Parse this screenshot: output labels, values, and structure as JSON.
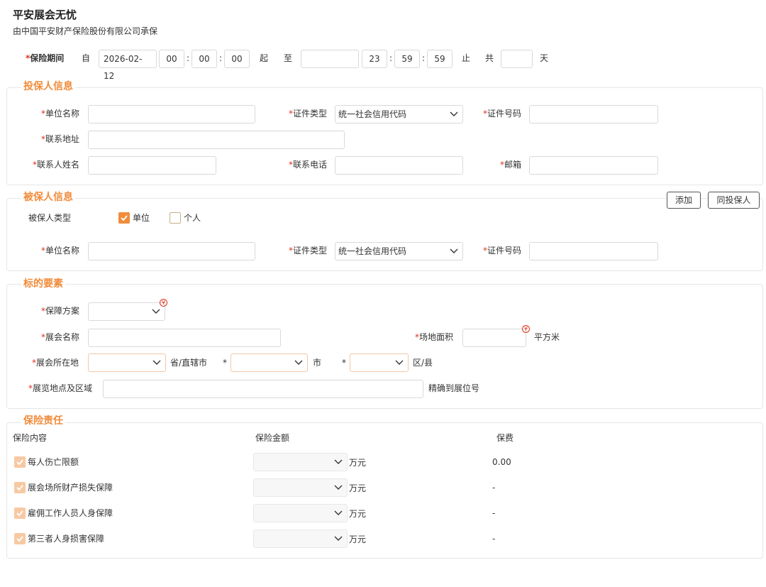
{
  "header": {
    "title": "平安展会无忧",
    "subtitle": "由中国平安财产保险股份有限公司承保"
  },
  "period": {
    "label": "保险期间",
    "from_word": "自",
    "start_date": "2026-02-12",
    "start_h": "00",
    "start_m": "00",
    "start_s": "00",
    "start_word": "起",
    "to_word": "至",
    "end_date": "",
    "end_h": "23",
    "end_m": "59",
    "end_s": "59",
    "end_word": "止",
    "total_word": "共",
    "days": "",
    "days_word": "天",
    "colon": ":"
  },
  "policyholder": {
    "title": "投保人信息",
    "unit_name_label": "单位名称",
    "id_type_label": "证件类型",
    "id_type_value": "统一社会信用代码",
    "id_no_label": "证件号码",
    "address_label": "联系地址",
    "contact_name_label": "联系人姓名",
    "phone_label": "联系电话",
    "email_label": "邮箱"
  },
  "insured": {
    "title": "被保人信息",
    "add_button": "添加",
    "same_button": "同投保人",
    "type_label": "被保人类型",
    "option_unit": "单位",
    "option_person": "个人",
    "unit_name_label": "单位名称",
    "id_type_label": "证件类型",
    "id_type_value": "统一社会信用代码",
    "id_no_label": "证件号码"
  },
  "subject": {
    "title": "标的要素",
    "plan_label": "保障方案",
    "expo_name_label": "展会名称",
    "area_label": "场地面积",
    "area_unit": "平方米",
    "location_label": "展会所在地",
    "province_suffix": "省/直辖市",
    "city_suffix": "市",
    "district_suffix": "区/县",
    "venue_label": "展览地点及区域",
    "venue_hint": "精确到展位号",
    "badge": "¥"
  },
  "liability": {
    "title": "保险责任",
    "col_content": "保险内容",
    "col_amount": "保险金额",
    "col_premium": "保费",
    "unit": "万元",
    "rows": [
      {
        "name": "每人伤亡限额",
        "premium": "0.00"
      },
      {
        "name": "展会场所财产损失保障",
        "premium": "-"
      },
      {
        "name": "雇佣工作人员人身保障",
        "premium": "-"
      },
      {
        "name": "第三者人身损害保障",
        "premium": "-"
      }
    ]
  },
  "colors": {
    "accent": "#f08c3c",
    "required": "#e0301e",
    "border": "#d9d9d9"
  }
}
